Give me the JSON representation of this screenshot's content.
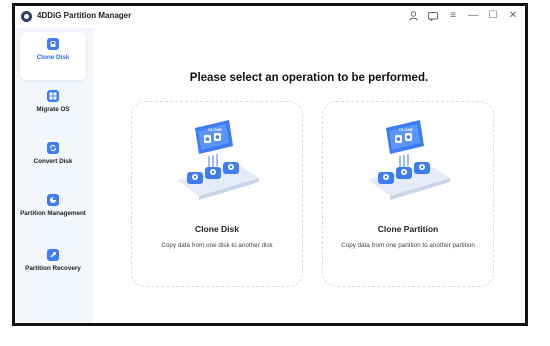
{
  "app": {
    "title": "4DDiG Partition Manager"
  },
  "titlebar": {
    "icons": [
      "account-icon",
      "feedback-icon",
      "menu-icon",
      "minimize-icon",
      "maximize-icon",
      "close-icon"
    ],
    "glyphs": {
      "menu": "≡",
      "minimize": "—",
      "maximize": "☐",
      "close": "✕"
    }
  },
  "sidebar": {
    "items": [
      {
        "label": "Clone Disk",
        "icon": "clone-disk-icon",
        "active": true
      },
      {
        "label": "Migrate OS",
        "icon": "migrate-os-icon",
        "active": false
      },
      {
        "label": "Convert Disk",
        "icon": "convert-disk-icon",
        "active": false
      },
      {
        "label": "Partition Management",
        "icon": "partition-management-icon",
        "active": false
      },
      {
        "label": "Partition Recovery",
        "icon": "partition-recovery-icon",
        "active": false
      }
    ]
  },
  "main": {
    "heading": "Please select an operation to be performed.",
    "cards": [
      {
        "title": "Clone Disk",
        "description": "Copy data from one disk to another disk",
        "illustration": "clone-disk-illustration"
      },
      {
        "title": "Clone Partition",
        "description": "Copy data from one partition to another partition",
        "illustration": "clone-partition-illustration"
      }
    ]
  },
  "colors": {
    "accent": "#3d7cf6",
    "frame": "#111111",
    "sidebar_bg": "#f3f6fb",
    "content_bg": "#ffffff"
  }
}
